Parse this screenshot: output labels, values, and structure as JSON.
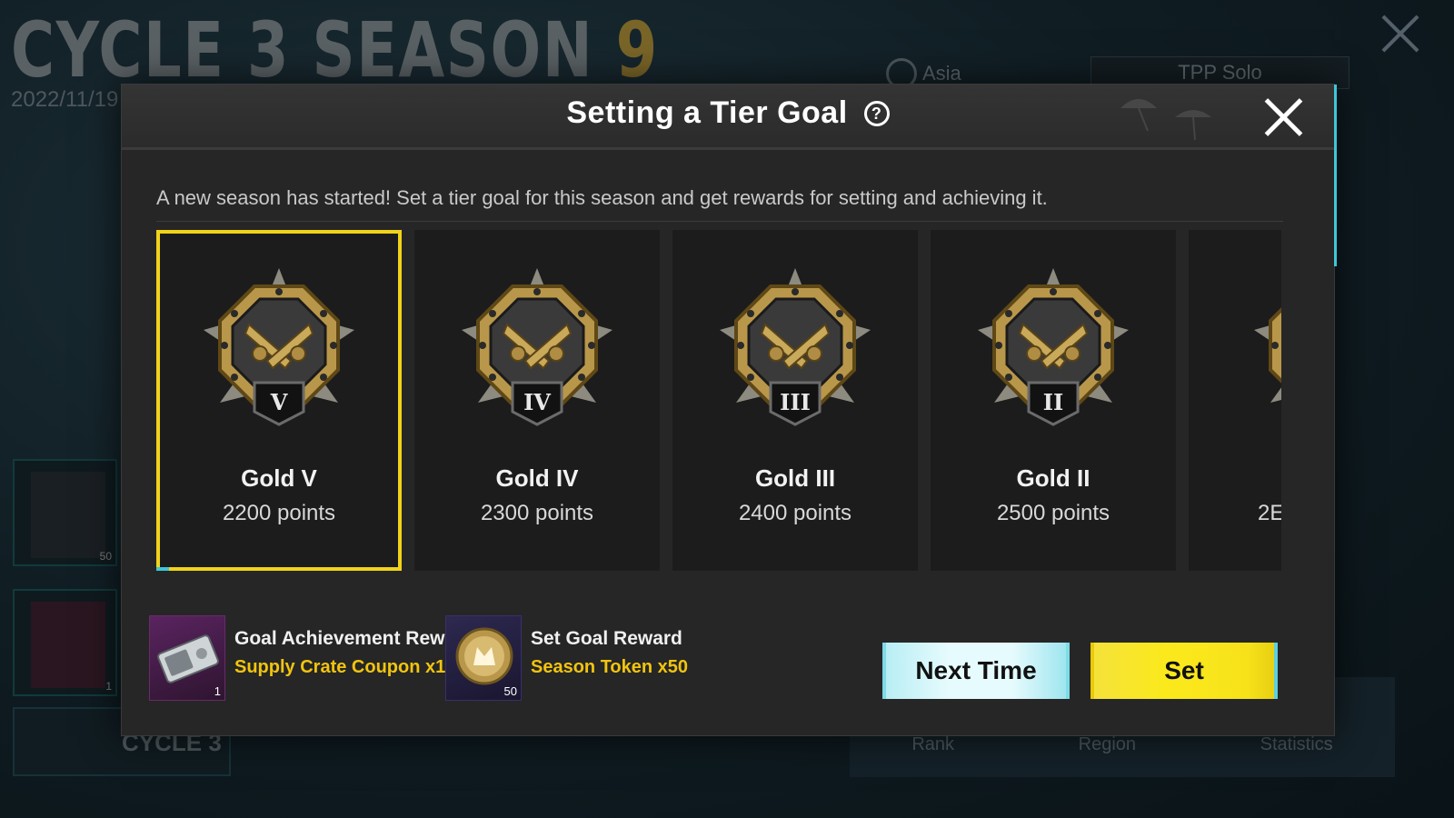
{
  "background": {
    "season_title_prefix": "CYCLE 3  SEASON ",
    "season_title_number": "9",
    "date_text": "2022/11/19 -",
    "region_label": "Asia",
    "mode_label": "TPP Solo",
    "reward_tile_1_count": "50",
    "reward_tile_2_count": "1",
    "cycle_label": "CYCLE 3",
    "tabs": [
      "Rank",
      "Region",
      "Statistics"
    ]
  },
  "modal": {
    "title": "Setting a Tier Goal",
    "help_glyph": "?",
    "description": "A new season has started! Set a tier goal for this season and get rewards for setting and achieving it.",
    "tiers": [
      {
        "name": "Gold V",
        "points": "2200 points",
        "numeral": "V",
        "selected": true
      },
      {
        "name": "Gold IV",
        "points": "2300 points",
        "numeral": "IV",
        "selected": false
      },
      {
        "name": "Gold III",
        "points": "2400 points",
        "numeral": "III",
        "selected": false
      },
      {
        "name": "Gold II",
        "points": "2500 points",
        "numeral": "II",
        "selected": false
      },
      {
        "name": "",
        "points": "2E",
        "numeral": "",
        "selected": false
      }
    ],
    "rewards": {
      "achievement": {
        "label": "Goal Achievement Reward",
        "value": "Supply Crate Coupon x1",
        "qty": "1",
        "icon": "coupon-icon"
      },
      "set_goal": {
        "label": "Set Goal Reward",
        "value": "Season Token x50",
        "qty": "50",
        "icon": "season-token-icon"
      }
    },
    "buttons": {
      "next_time": "Next Time",
      "set": "Set"
    }
  },
  "colors": {
    "accent_yellow": "#f1d31a",
    "accent_cyan": "#3ec7d8",
    "reward_text": "#f1c40f",
    "badge_gold": "#b9974a"
  }
}
